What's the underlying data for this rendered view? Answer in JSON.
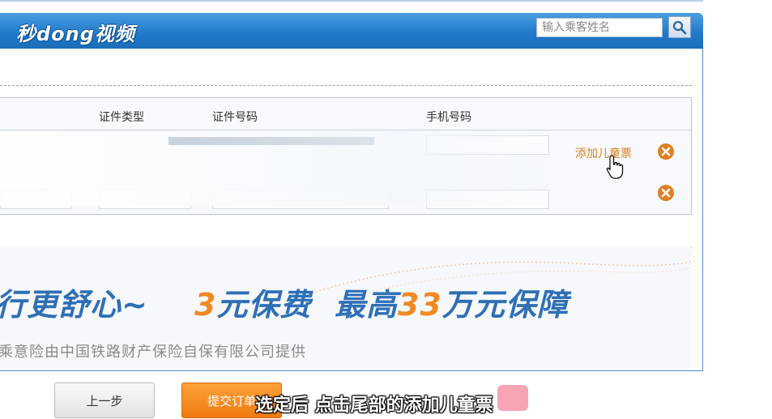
{
  "header": {
    "logo_text": "秒dong视频",
    "search_placeholder": "输入乘客姓名"
  },
  "passenger_table": {
    "columns": [
      "证件类型",
      "证件号码",
      "手机号码"
    ],
    "add_child_ticket_label": "添加儿童票"
  },
  "insurance_banner": {
    "headline_left": "行更舒心~",
    "fee_amount": "3",
    "fee_text": "元保费",
    "max_prefix": "最高",
    "max_amount": "33",
    "max_suffix": "万元保障",
    "provider_text": "乘意险由中国铁路财产保险自保有限公司提供"
  },
  "buttons": {
    "prev_label": "上一步",
    "submit_label": "提交订单"
  },
  "video_subtitle": "选定后 点击尾部的添加儿童票",
  "colors": {
    "header_blue": "#1f78c8",
    "accent_orange": "#f08a24",
    "banner_blue": "#2f6fb6"
  }
}
